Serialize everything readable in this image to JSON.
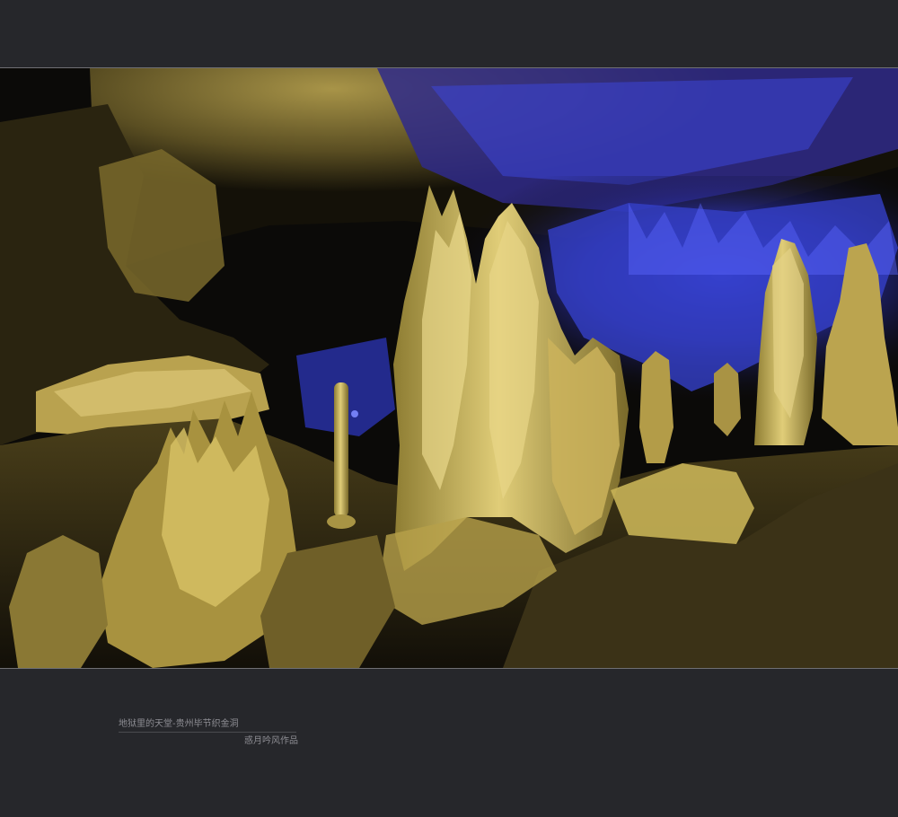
{
  "caption": {
    "title": "地狱里的天堂-贵州毕节织金洞",
    "author": "惑月吟风作品"
  },
  "palette": {
    "background": "#26272b",
    "rock_gold": "#c9b455",
    "cave_blue": "#3a3fd6",
    "shadow": "#0b0a08"
  }
}
